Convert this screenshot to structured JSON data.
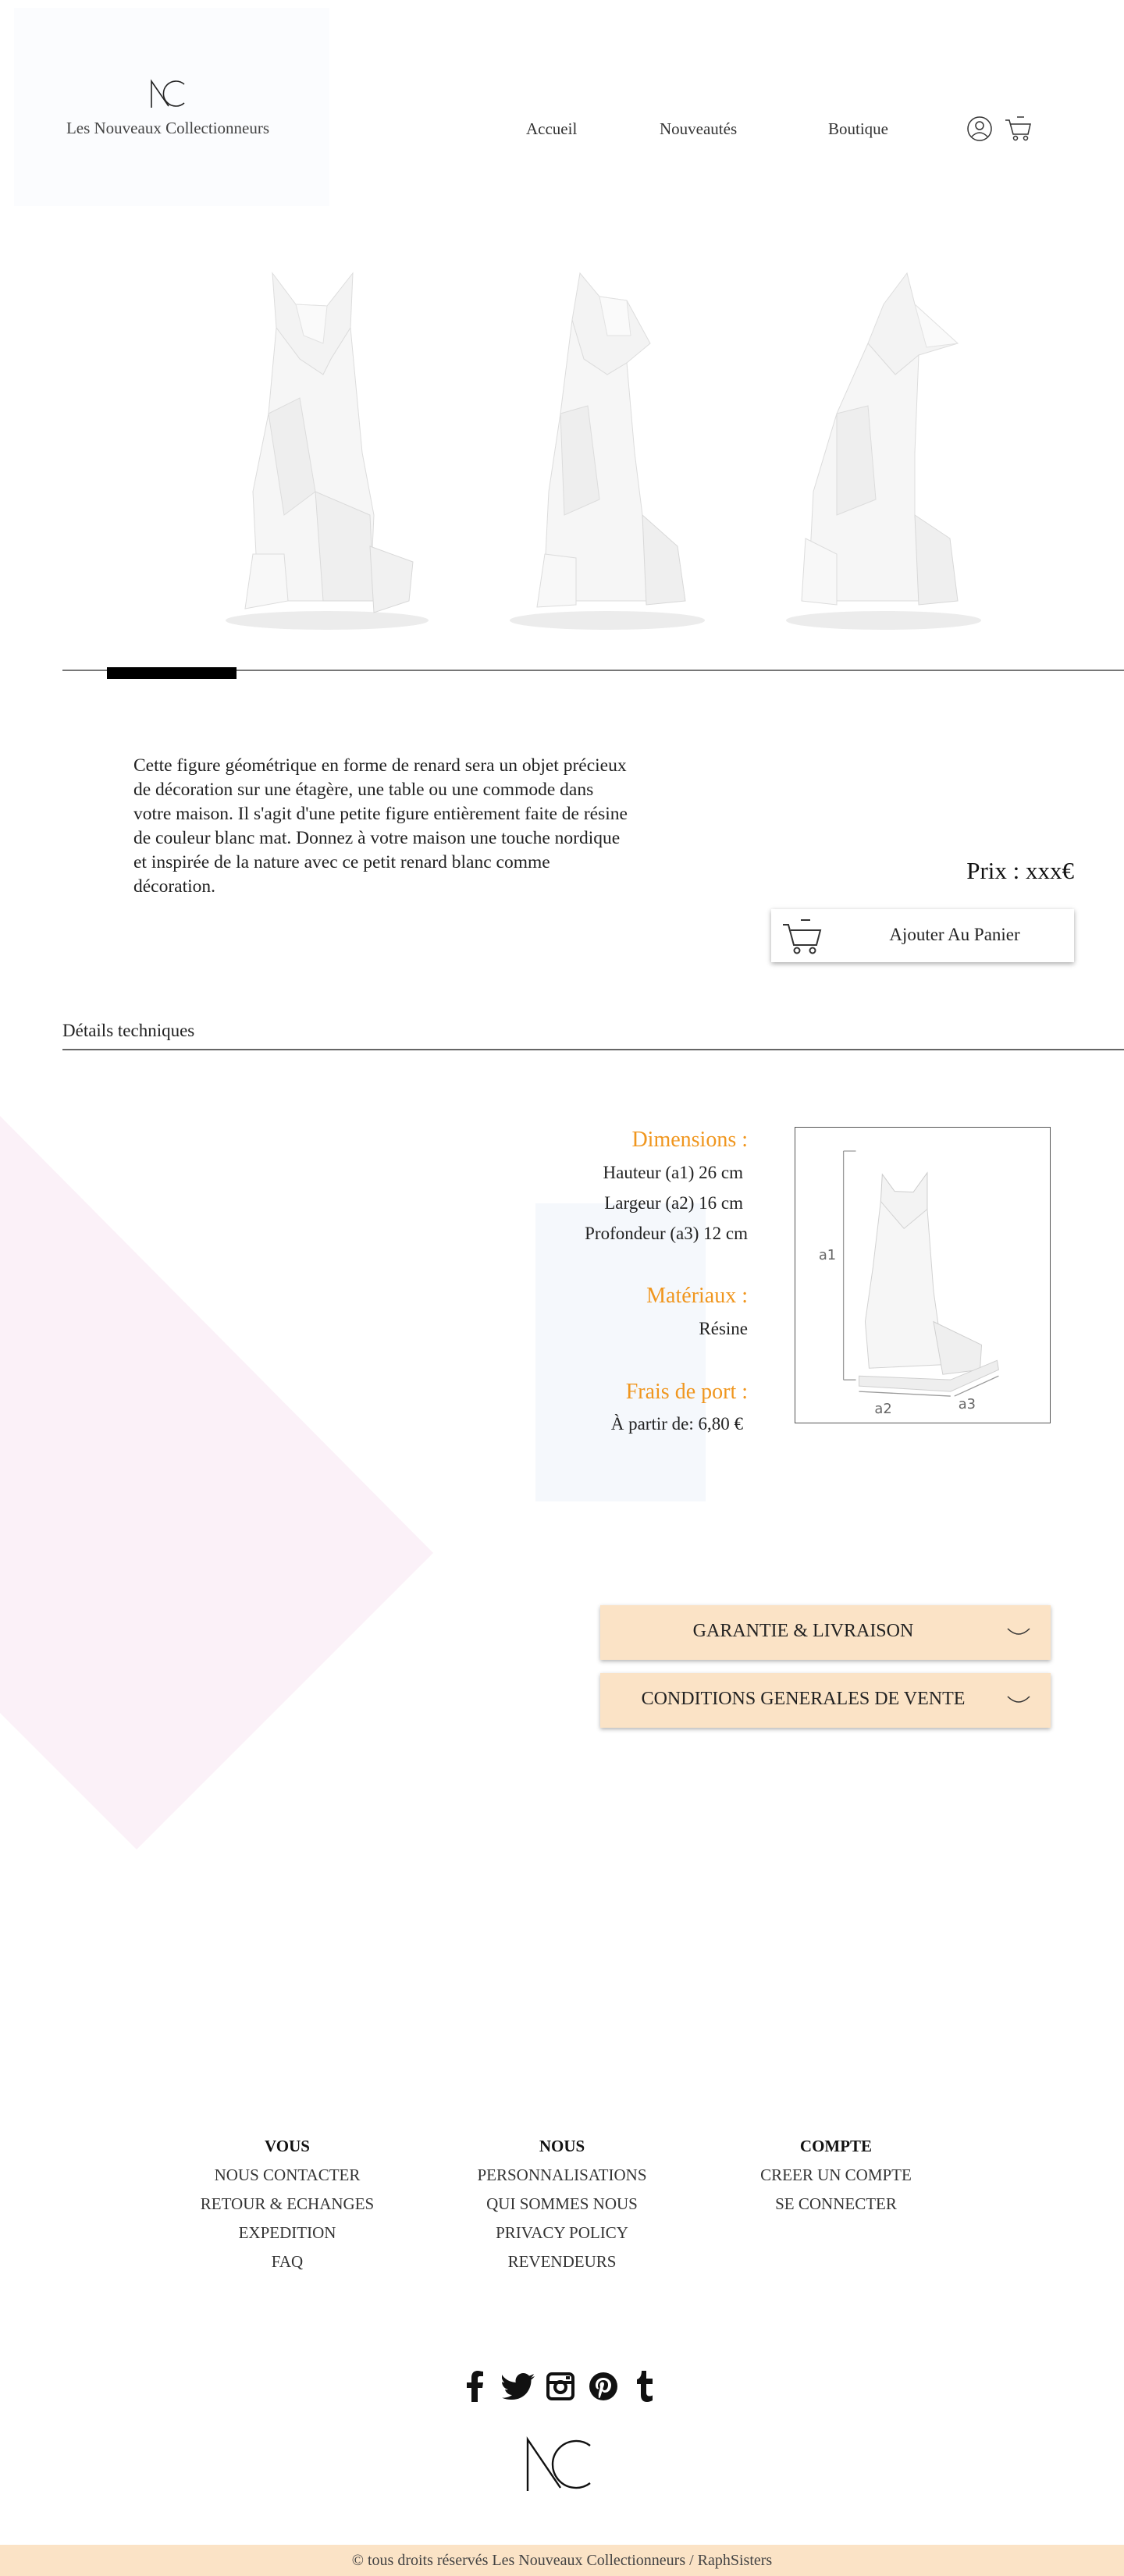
{
  "header": {
    "brand_name": "Les Nouveaux Collectionneurs",
    "nav": [
      {
        "label": "Accueil"
      },
      {
        "label": "Nouveautés"
      },
      {
        "label": "Boutique"
      }
    ],
    "icons": [
      "user-icon",
      "cart-icon"
    ]
  },
  "gallery": {
    "images": [
      "fox-front-view",
      "fox-three-quarter-view",
      "fox-side-view"
    ],
    "active_index": 0
  },
  "product": {
    "description": "Cette figure géométrique en forme de renard sera un objet précieux de décoration sur une étagère, une table ou une commode dans votre maison. Il s'agit d'une petite figure entièrement faite de résine de couleur blanc mat. Donnez à votre maison une touche nordique et inspirée de la nature avec ce petit renard blanc comme décoration.",
    "price": "Prix : xxx€",
    "add_to_cart_label": "Ajouter Au Panier"
  },
  "details": {
    "title": "Détails techniques",
    "dimensions_head": "Dimensions :",
    "height": "Hauteur (a1) 26 cm",
    "width": "Largeur (a2) 16 cm",
    "depth": "Profondeur (a3) 12 cm",
    "materials_head": "Matériaux :",
    "material": "Résine",
    "shipping_head": "Frais de port :",
    "shipping": "À partir de: 6,80 €",
    "diagram_labels": {
      "a1": "a1",
      "a2": "a2",
      "a3": "a3"
    }
  },
  "accordions": [
    {
      "label": "GARANTIE & LIVRAISON"
    },
    {
      "label": "CONDITIONS GENERALES DE VENTE"
    }
  ],
  "footer": {
    "columns": [
      {
        "title": "VOUS",
        "links": [
          "NOUS CONTACTER",
          "RETOUR & ECHANGES",
          "EXPEDITION",
          "FAQ"
        ]
      },
      {
        "title": "NOUS",
        "links": [
          "PERSONNALISATIONS",
          "QUI SOMMES NOUS",
          "PRIVACY POLICY",
          "REVENDEURS"
        ]
      },
      {
        "title": "COMPTE",
        "links": [
          "CREER UN COMPTE",
          "SE CONNECTER"
        ]
      }
    ],
    "social_icons": [
      "facebook-icon",
      "twitter-icon",
      "instagram-icon",
      "pinterest-icon",
      "tumblr-icon"
    ],
    "copyright": "© tous droits réservés Les Nouveaux Collectionneurs / RaphSisters"
  },
  "colors": {
    "accent_orange": "#f0961e",
    "peach": "#fbe3c6",
    "pink_deco": "#fbf1f8",
    "light_blue": "#f5f8fc"
  }
}
